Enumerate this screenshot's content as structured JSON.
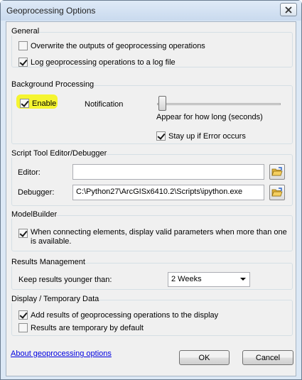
{
  "window": {
    "title": "Geoprocessing Options"
  },
  "general": {
    "title": "General",
    "overwrite": {
      "label": "Overwrite the outputs of geoprocessing operations",
      "checked": false
    },
    "log": {
      "label": "Log geoprocessing operations to a log file",
      "checked": true
    }
  },
  "background": {
    "title": "Background Processing",
    "enable": {
      "label": "Enable",
      "checked": true
    },
    "notification_label": "Notification",
    "appear_label": "Appear for how long (seconds)",
    "stay_up": {
      "label": "Stay up if Error occurs",
      "checked": true
    }
  },
  "script": {
    "title": "Script Tool Editor/Debugger",
    "editor_label": "Editor:",
    "editor_value": "",
    "debugger_label": "Debugger:",
    "debugger_value": "C:\\Python27\\ArcGISx6410.2\\Scripts\\ipython.exe"
  },
  "modelbuilder": {
    "title": "ModelBuilder",
    "valid_params": {
      "label": "When connecting elements, display valid parameters when more than one is available.",
      "checked": true
    }
  },
  "results": {
    "title": "Results Management",
    "keep_label": "Keep results younger than:",
    "keep_value": "2 Weeks"
  },
  "display": {
    "title": "Display / Temporary Data",
    "add_results": {
      "label": "Add results of geoprocessing operations to the display",
      "checked": true
    },
    "temporary": {
      "label": "Results are temporary by default",
      "checked": false
    }
  },
  "footer": {
    "about_link": "About geoprocessing options",
    "ok_label": "OK",
    "cancel_label": "Cancel"
  },
  "colors": {
    "highlight": "#f5f530",
    "link": "#0000e0"
  }
}
